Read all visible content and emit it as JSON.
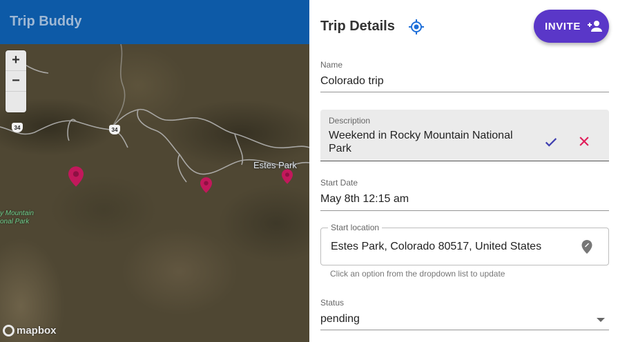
{
  "app": {
    "title": "Trip Buddy"
  },
  "map": {
    "zoom_in": "+",
    "zoom_out": "−",
    "place_label": "Estes Park",
    "park_label_line1": "y Mountain",
    "park_label_line2": "onal Park",
    "route_shield_1": "34",
    "route_shield_2": "34",
    "attribution": "mapbox",
    "pin_color": "#c2185b"
  },
  "panel": {
    "title": "Trip Details",
    "invite_label": "INVITE",
    "name": {
      "label": "Name",
      "value": "Colorado trip"
    },
    "description": {
      "label": "Description",
      "value": "Weekend in Rocky Mountain National Park"
    },
    "start_date": {
      "label": "Start Date",
      "value": "May 8th 12:15 am"
    },
    "start_location": {
      "label": "Start location",
      "value": "Estes Park, Colorado 80517, United States",
      "helper": "Click an option from the dropdown list to update"
    },
    "status": {
      "label": "Status",
      "value": "pending"
    }
  },
  "colors": {
    "app_bar": "#0d5aa7",
    "accent": "#5a37c8",
    "locate": "#1e6fd9",
    "confirm": "#3f3fb0",
    "cancel": "#e01e5a"
  }
}
